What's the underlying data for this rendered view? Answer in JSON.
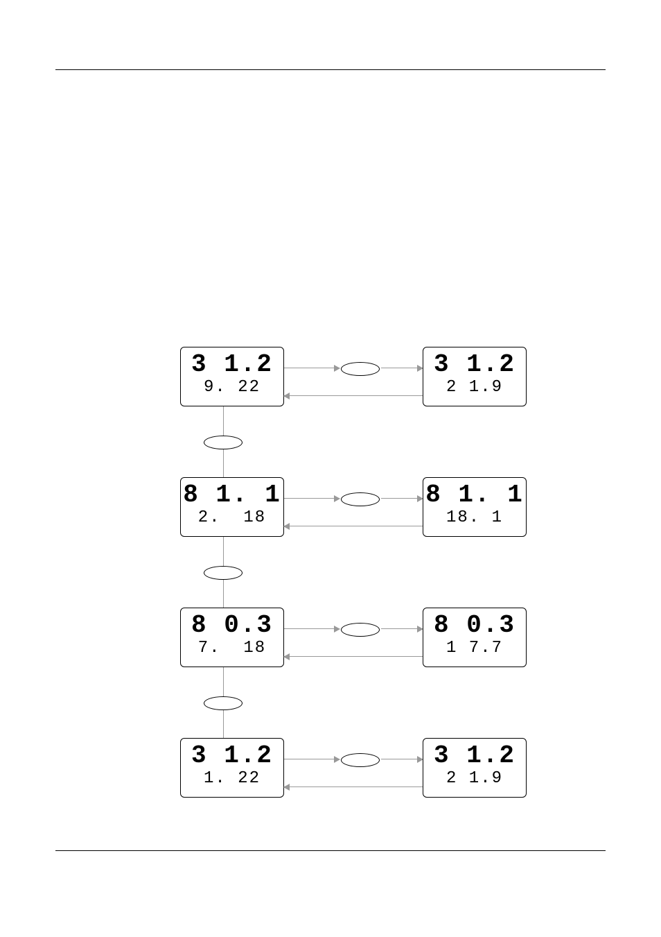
{
  "rows": [
    {
      "left_big": "3 1.2",
      "left_small": "9. 22",
      "right_big": "3 1.2",
      "right_small": "2 1.9"
    },
    {
      "left_big": "8 1. 1",
      "left_small": "2.  18",
      "right_big": "8 1. 1",
      "right_small": "18. 1"
    },
    {
      "left_big": "8 0.3",
      "left_small": "7.  18",
      "right_big": "8 0.3",
      "right_small": "1 7.7"
    },
    {
      "left_big": "3 1.2",
      "left_small": "1. 22",
      "right_big": "3 1.2",
      "right_small": "2 1.9"
    }
  ]
}
